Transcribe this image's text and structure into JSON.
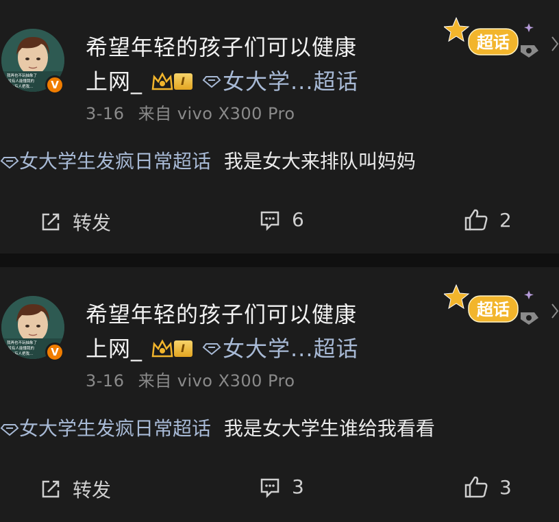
{
  "posts": [
    {
      "author_line1": "希望年轻的孩子们可以健康",
      "author_line2": "上网_",
      "level": "I",
      "chat_tag": "女大学...超话",
      "date": "3-16",
      "device": "来自 vivo X300 Pro",
      "avatar_text": [
        "我再也不玩抽象了",
        "一没有人能懂我的",
        "我的有人把我..."
      ],
      "verified_badge": "V",
      "supertopic_badge": "超话",
      "topic": "女大学生发疯日常超话",
      "text": "我是女大来排队叫妈妈",
      "share_label": "转发",
      "comments": "6",
      "likes": "2"
    },
    {
      "author_line1": "希望年轻的孩子们可以健康",
      "author_line2": "上网_",
      "level": "I",
      "chat_tag": "女大学...超话",
      "date": "3-16",
      "device": "来自 vivo X300 Pro",
      "avatar_text": [
        "我再也不玩抽象了",
        "一没有人能懂我的",
        "我的有人把我..."
      ],
      "verified_badge": "V",
      "supertopic_badge": "超话",
      "topic": "女大学生发疯日常超话",
      "text": "我是女大学生谁给我看看",
      "share_label": "转发",
      "comments": "3",
      "likes": "3"
    }
  ],
  "colors": {
    "background": "#101010",
    "card": "#1c1c1c",
    "topic_link": "#a8bad6",
    "meta": "#8a8a8a",
    "verified": "#f07d00",
    "badge_gold": "#f2b52c"
  },
  "icons": [
    "share-icon",
    "comment-icon",
    "like-icon",
    "crown-icon",
    "diamond-icon",
    "star-icon",
    "chevron-right-icon"
  ]
}
